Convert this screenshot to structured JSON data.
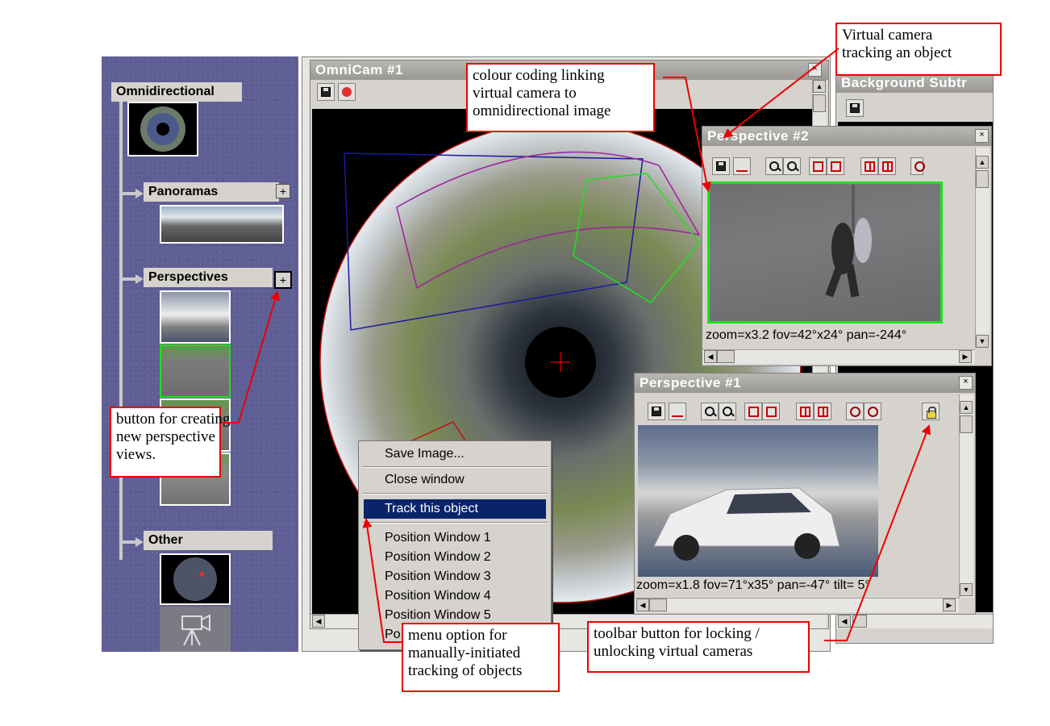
{
  "tree": {
    "omnidirectional": "Omnidirectional",
    "panoramas": "Panoramas",
    "perspectives": "Perspectives",
    "other": "Other",
    "add_symbol": "+"
  },
  "omnicam": {
    "title": "OmniCam #1"
  },
  "background": {
    "title": "Background Subtr"
  },
  "perspective2": {
    "title": "Perspective #2",
    "status": "zoom=x3.2  fov=42°x24°  pan=-244°"
  },
  "perspective1": {
    "title": "Perspective #1",
    "status": "zoom=x1.8  fov=71°x35°  pan=-47°  tilt= 5°"
  },
  "menu": {
    "items": [
      "Save Image...",
      "Close window",
      "Track this object",
      "Position Window 1",
      "Position Window 2",
      "Position Window 3",
      "Position Window 4",
      "Position Window 5",
      "Po"
    ]
  },
  "callouts": {
    "virtual_camera": [
      "Virtual camera",
      "tracking an object"
    ],
    "colour_coding": [
      "colour coding linking",
      "virtual camera to",
      "omnidirectional image"
    ],
    "new_perspective": [
      "button for creating",
      "new perspective",
      "views."
    ],
    "menu_option": [
      "menu option for",
      "manually-initiated",
      "tracking of objects"
    ],
    "lock_button": [
      "toolbar button for locking /",
      "unlocking virtual cameras"
    ]
  },
  "colors": {
    "annotation": "#e00000",
    "menu_highlight": "#0a246a",
    "view_blue": "#1a1aa0",
    "view_magenta": "#a020a0",
    "view_green": "#20e020",
    "view_red": "#c01010"
  }
}
